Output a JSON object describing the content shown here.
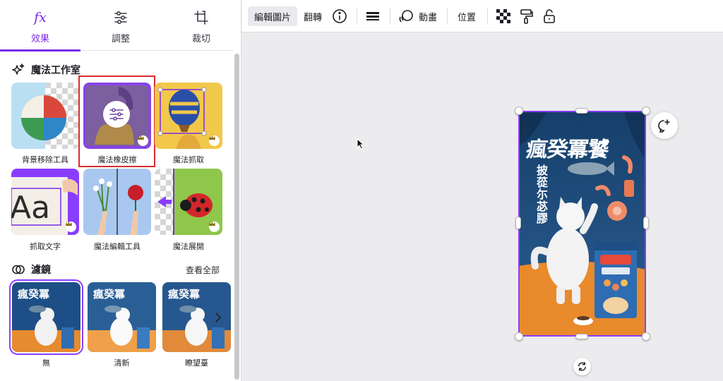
{
  "tabs": [
    {
      "label": "效果",
      "icon": "fx-icon",
      "active": true
    },
    {
      "label": "調整",
      "icon": "sliders-icon"
    },
    {
      "label": "裁切",
      "icon": "crop-icon"
    }
  ],
  "magic_studio": {
    "title": "魔法工作室",
    "tools": [
      {
        "label": "背景移除工具",
        "premium": false
      },
      {
        "label": "魔法橡皮擦",
        "premium": true,
        "highlighted": true
      },
      {
        "label": "魔法抓取",
        "premium": true
      },
      {
        "label": "抓取文字",
        "premium": true
      },
      {
        "label": "魔法編輯工具",
        "premium": false
      },
      {
        "label": "魔法展開",
        "premium": true
      }
    ]
  },
  "filters": {
    "title": "濾鏡",
    "see_all": "查看全部",
    "items": [
      {
        "label": "無",
        "selected": true
      },
      {
        "label": "清新"
      },
      {
        "label": "瞭望臺"
      }
    ]
  },
  "toolbar": {
    "edit_image": "編輯圖片",
    "flip": "翻轉",
    "animate": "動畫",
    "position": "位置"
  },
  "poster": {
    "headline": "瘋癸冪饕",
    "subheadline": "披蓯尓苾膠",
    "product_image_alt": "Cat food bag: brand and 'Seafood' text appear on the pictured package (rendered as image, not reproduced as text)"
  },
  "colors": {
    "accent": "#7d2ae8",
    "selection": "#8b3dff",
    "highlight": "#d92d2d",
    "poster_blue": "#20507e",
    "poster_orange": "#e98a2c"
  }
}
